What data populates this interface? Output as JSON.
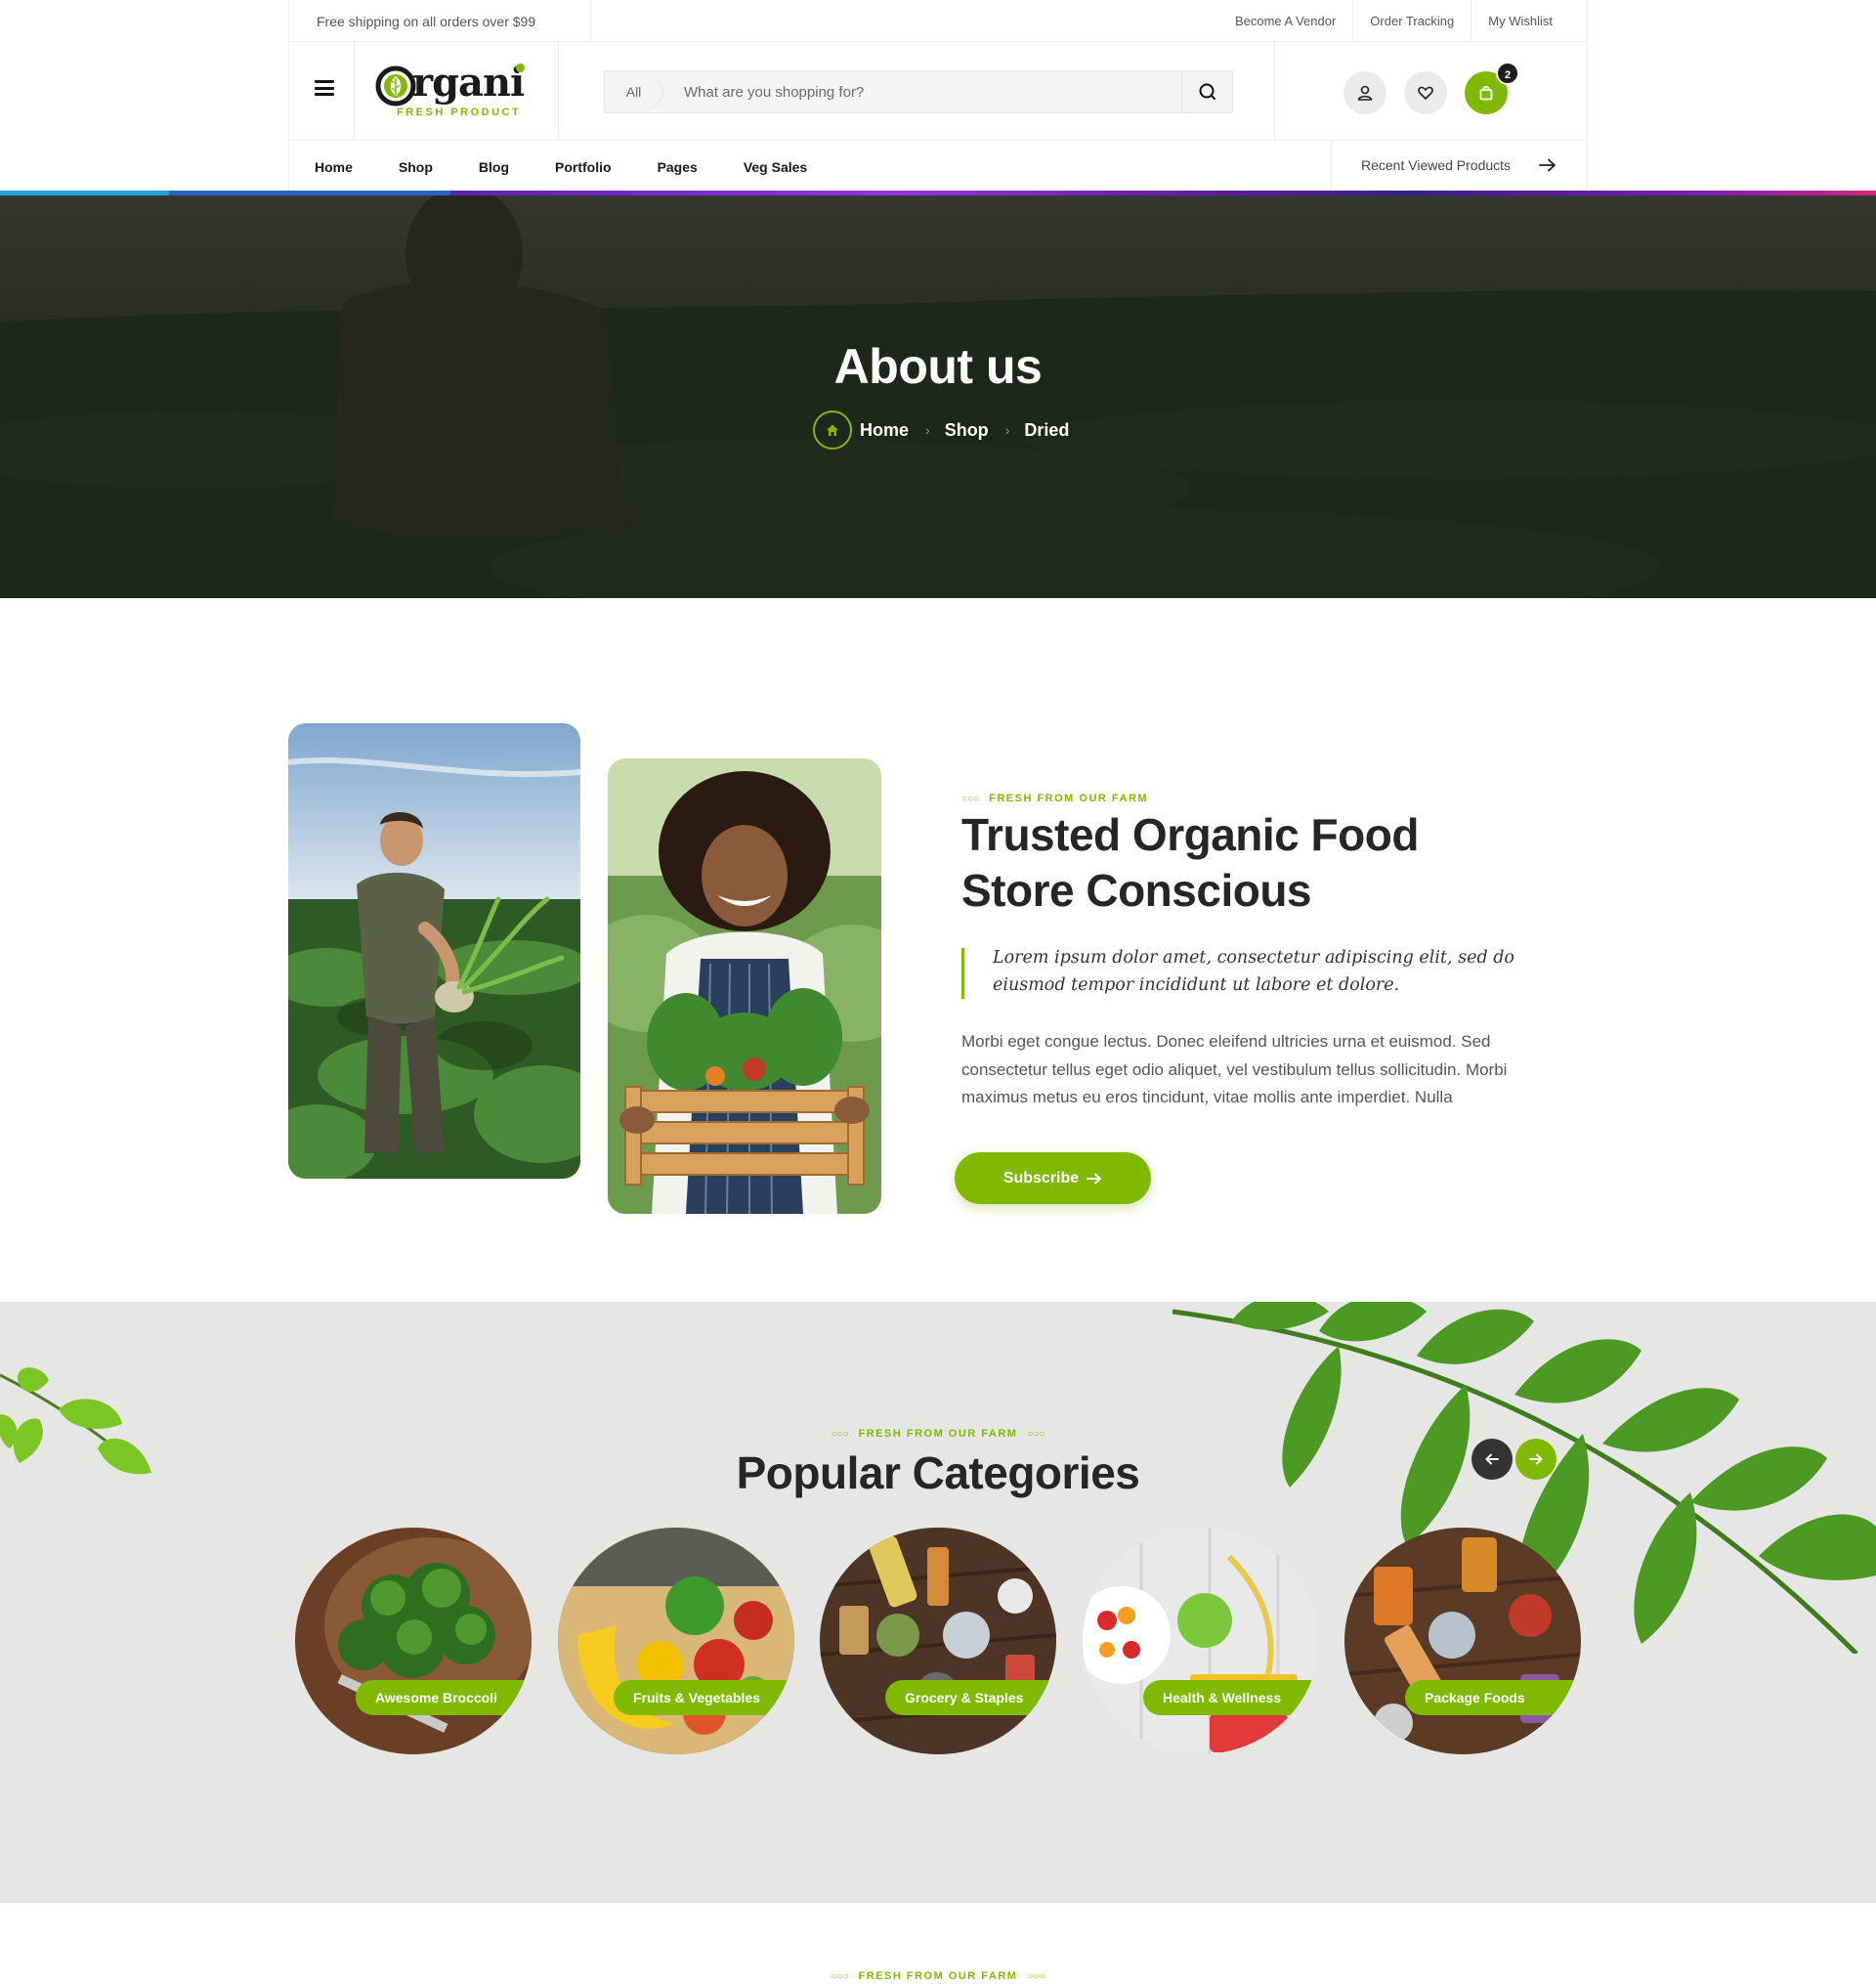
{
  "topbar": {
    "shipping": "Free shipping on all orders over $99",
    "links": [
      "Become A Vendor",
      "Order Tracking",
      "My Wishlist"
    ]
  },
  "header": {
    "logo_word": "rgani",
    "logo_tagline": "FRESH PRODUCT",
    "search_category": "All",
    "search_placeholder": "What are you shopping for?",
    "cart_count": "2"
  },
  "nav": {
    "items": [
      "Home",
      "Shop",
      "Blog",
      "Portfolio",
      "Pages",
      "Veg Sales"
    ],
    "recent": "Recent Viewed Products"
  },
  "hero": {
    "title": "About us",
    "breadcrumb": [
      "Home",
      "Shop",
      "Dried"
    ]
  },
  "about": {
    "eyebrow": "FRESH FROM OUR FARM",
    "heading_line1": "Trusted Organic Food",
    "heading_line2": "Store Conscious",
    "quote": "Lorem ipsum dolor amet, consectetur adipiscing elit, sed do eiusmod tempor incididunt ut labore et dolore.",
    "body": "Morbi eget congue lectus. Donec eleifend ultricies urna et euismod. Sed consectetur tellus eget odio aliquet, vel vestibulum tellus sollicitudin. Morbi maximus metus eu eros tincidunt, vitae mollis ante imperdiet. Nulla",
    "button": "Subscribe"
  },
  "categories": {
    "eyebrow": "FRESH FROM OUR FARM",
    "title": "Popular Categories",
    "items": [
      "Awesome Broccoli",
      "Fruits & Vegetables",
      "Grocery & Staples",
      "Health & Wellness",
      "Package Foods"
    ]
  },
  "next_section": {
    "eyebrow": "FRESH FROM OUR FARM"
  },
  "colors": {
    "accent": "#7fba00",
    "dark": "#262626"
  }
}
